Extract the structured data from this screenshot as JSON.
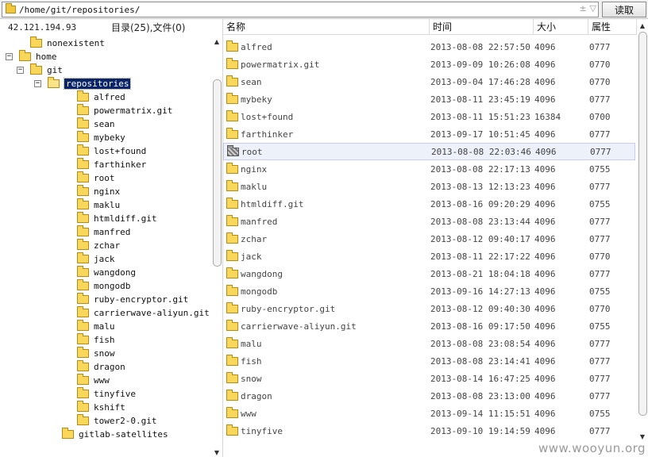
{
  "topbar": {
    "path": "/home/git/repositories/",
    "read_button": "读取",
    "arrow_up": "±",
    "arrow_down": "▽"
  },
  "left_panel": {
    "ip": "42.121.194.93",
    "counts": "目录(25),文件(0)",
    "tree": [
      {
        "label": "nonexistent",
        "depth": 1,
        "toggle": "",
        "open": false,
        "selected": false
      },
      {
        "label": "home",
        "depth": 0,
        "toggle": "−",
        "open": false,
        "selected": false
      },
      {
        "label": "git",
        "depth": 1,
        "toggle": "−",
        "open": false,
        "selected": false
      },
      {
        "label": "repositories",
        "depth": 2,
        "toggle": "−",
        "open": true,
        "selected": true
      },
      {
        "label": "alfred",
        "depth": 3,
        "toggle": "",
        "open": false,
        "selected": false
      },
      {
        "label": "powermatrix.git",
        "depth": 3,
        "toggle": "",
        "open": false,
        "selected": false
      },
      {
        "label": "sean",
        "depth": 3,
        "toggle": "",
        "open": false,
        "selected": false
      },
      {
        "label": "mybeky",
        "depth": 3,
        "toggle": "",
        "open": false,
        "selected": false
      },
      {
        "label": "lost+found",
        "depth": 3,
        "toggle": "",
        "open": false,
        "selected": false
      },
      {
        "label": "farthinker",
        "depth": 3,
        "toggle": "",
        "open": false,
        "selected": false
      },
      {
        "label": "root",
        "depth": 3,
        "toggle": "",
        "open": false,
        "selected": false
      },
      {
        "label": "nginx",
        "depth": 3,
        "toggle": "",
        "open": false,
        "selected": false
      },
      {
        "label": "maklu",
        "depth": 3,
        "toggle": "",
        "open": false,
        "selected": false
      },
      {
        "label": "htmldiff.git",
        "depth": 3,
        "toggle": "",
        "open": false,
        "selected": false
      },
      {
        "label": "manfred",
        "depth": 3,
        "toggle": "",
        "open": false,
        "selected": false
      },
      {
        "label": "zchar",
        "depth": 3,
        "toggle": "",
        "open": false,
        "selected": false
      },
      {
        "label": "jack",
        "depth": 3,
        "toggle": "",
        "open": false,
        "selected": false
      },
      {
        "label": "wangdong",
        "depth": 3,
        "toggle": "",
        "open": false,
        "selected": false
      },
      {
        "label": "mongodb",
        "depth": 3,
        "toggle": "",
        "open": false,
        "selected": false
      },
      {
        "label": "ruby-encryptor.git",
        "depth": 3,
        "toggle": "",
        "open": false,
        "selected": false
      },
      {
        "label": "carrierwave-aliyun.git",
        "depth": 3,
        "toggle": "",
        "open": false,
        "selected": false
      },
      {
        "label": "malu",
        "depth": 3,
        "toggle": "",
        "open": false,
        "selected": false
      },
      {
        "label": "fish",
        "depth": 3,
        "toggle": "",
        "open": false,
        "selected": false
      },
      {
        "label": "snow",
        "depth": 3,
        "toggle": "",
        "open": false,
        "selected": false
      },
      {
        "label": "dragon",
        "depth": 3,
        "toggle": "",
        "open": false,
        "selected": false
      },
      {
        "label": "www",
        "depth": 3,
        "toggle": "",
        "open": false,
        "selected": false
      },
      {
        "label": "tinyfive",
        "depth": 3,
        "toggle": "",
        "open": false,
        "selected": false
      },
      {
        "label": "kshift",
        "depth": 3,
        "toggle": "",
        "open": false,
        "selected": false
      },
      {
        "label": "tower2-0.git",
        "depth": 3,
        "toggle": "",
        "open": false,
        "selected": false
      },
      {
        "label": "gitlab-satellites",
        "depth": 2,
        "toggle": "",
        "open": false,
        "selected": false
      }
    ]
  },
  "right_panel": {
    "columns": {
      "name": "名称",
      "time": "时间",
      "size": "大小",
      "perm": "属性"
    },
    "rows": [
      {
        "name": "alfred",
        "time": "2013-08-08 22:57:50",
        "size": "4096",
        "perm": "0777",
        "hatched": false,
        "highlight": false
      },
      {
        "name": "powermatrix.git",
        "time": "2013-09-09 10:26:08",
        "size": "4096",
        "perm": "0770",
        "hatched": false,
        "highlight": false
      },
      {
        "name": "sean",
        "time": "2013-09-04 17:46:28",
        "size": "4096",
        "perm": "0770",
        "hatched": false,
        "highlight": false
      },
      {
        "name": "mybeky",
        "time": "2013-08-11 23:45:19",
        "size": "4096",
        "perm": "0777",
        "hatched": false,
        "highlight": false
      },
      {
        "name": "lost+found",
        "time": "2013-08-11 15:51:23",
        "size": "16384",
        "perm": "0700",
        "hatched": false,
        "highlight": false
      },
      {
        "name": "farthinker",
        "time": "2013-09-17 10:51:45",
        "size": "4096",
        "perm": "0777",
        "hatched": false,
        "highlight": false
      },
      {
        "name": "root",
        "time": "2013-08-08 22:03:46",
        "size": "4096",
        "perm": "0777",
        "hatched": true,
        "highlight": true
      },
      {
        "name": "nginx",
        "time": "2013-08-08 22:17:13",
        "size": "4096",
        "perm": "0755",
        "hatched": false,
        "highlight": false
      },
      {
        "name": "maklu",
        "time": "2013-08-13 12:13:23",
        "size": "4096",
        "perm": "0777",
        "hatched": false,
        "highlight": false
      },
      {
        "name": "htmldiff.git",
        "time": "2013-08-16 09:20:29",
        "size": "4096",
        "perm": "0755",
        "hatched": false,
        "highlight": false
      },
      {
        "name": "manfred",
        "time": "2013-08-08 23:13:44",
        "size": "4096",
        "perm": "0777",
        "hatched": false,
        "highlight": false
      },
      {
        "name": "zchar",
        "time": "2013-08-12 09:40:17",
        "size": "4096",
        "perm": "0777",
        "hatched": false,
        "highlight": false
      },
      {
        "name": "jack",
        "time": "2013-08-11 22:17:22",
        "size": "4096",
        "perm": "0770",
        "hatched": false,
        "highlight": false
      },
      {
        "name": "wangdong",
        "time": "2013-08-21 18:04:18",
        "size": "4096",
        "perm": "0777",
        "hatched": false,
        "highlight": false
      },
      {
        "name": "mongodb",
        "time": "2013-09-16 14:27:13",
        "size": "4096",
        "perm": "0755",
        "hatched": false,
        "highlight": false
      },
      {
        "name": "ruby-encryptor.git",
        "time": "2013-08-12 09:40:30",
        "size": "4096",
        "perm": "0770",
        "hatched": false,
        "highlight": false
      },
      {
        "name": "carrierwave-aliyun.git",
        "time": "2013-08-16 09:17:50",
        "size": "4096",
        "perm": "0755",
        "hatched": false,
        "highlight": false
      },
      {
        "name": "malu",
        "time": "2013-08-08 23:08:54",
        "size": "4096",
        "perm": "0777",
        "hatched": false,
        "highlight": false
      },
      {
        "name": "fish",
        "time": "2013-08-08 23:14:41",
        "size": "4096",
        "perm": "0777",
        "hatched": false,
        "highlight": false
      },
      {
        "name": "snow",
        "time": "2013-08-14 16:47:25",
        "size": "4096",
        "perm": "0777",
        "hatched": false,
        "highlight": false
      },
      {
        "name": "dragon",
        "time": "2013-08-08 23:13:00",
        "size": "4096",
        "perm": "0777",
        "hatched": false,
        "highlight": false
      },
      {
        "name": "www",
        "time": "2013-09-14 11:15:51",
        "size": "4096",
        "perm": "0755",
        "hatched": false,
        "highlight": false
      },
      {
        "name": "tinyfive",
        "time": "2013-09-10 19:14:59",
        "size": "4096",
        "perm": "0777",
        "hatched": false,
        "highlight": false
      }
    ]
  },
  "watermark": "www.wooyun.org",
  "colors": {
    "selection": "#0a246a",
    "folder": "#f8d75a",
    "row_highlight": "#eef0fa"
  },
  "icons": {
    "folder": "folder-icon",
    "scroll_up": "scroll-up-arrow",
    "scroll_down": "scroll-down-arrow"
  }
}
